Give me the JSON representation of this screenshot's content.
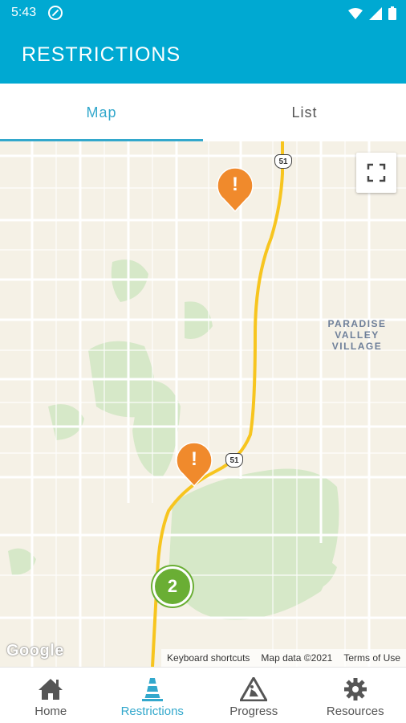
{
  "status_bar": {
    "time": "5:43"
  },
  "app_bar": {
    "title": "RESTRICTIONS"
  },
  "tabs": [
    {
      "label": "Map",
      "active": true
    },
    {
      "label": "List",
      "active": false
    }
  ],
  "map": {
    "place_label_line1": "PARADISE",
    "place_label_line2": "VALLEY VILLAGE",
    "route_shield_top": "51",
    "route_shield_mid": "51",
    "cluster_count": "2",
    "google_logo": "Google",
    "attribution": {
      "keyboard": "Keyboard shortcuts",
      "map_data": "Map data ©2021",
      "terms": "Terms of Use"
    },
    "colors": {
      "route": "#f7c51f",
      "marker": "#f08a2c",
      "cluster": "#6aae34",
      "park": "#d6e8c8"
    }
  },
  "bottom_nav": [
    {
      "label": "Home",
      "icon": "home-icon",
      "active": false
    },
    {
      "label": "Restrictions",
      "icon": "traffic-cone-icon",
      "active": true
    },
    {
      "label": "Progress",
      "icon": "road-work-icon",
      "active": false
    },
    {
      "label": "Resources",
      "icon": "gear-icon",
      "active": false
    }
  ],
  "accent_color": "#00a9d2"
}
